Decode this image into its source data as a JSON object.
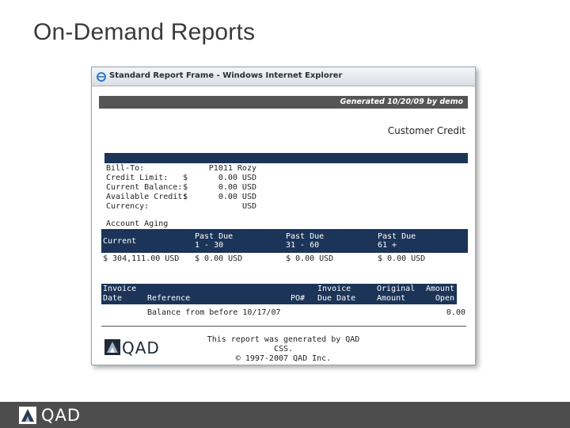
{
  "slide": {
    "title": "On-Demand Reports"
  },
  "window": {
    "title": "Standard Report Frame - Windows Internet Explorer"
  },
  "report": {
    "generated": "Generated 10/20/09 by demo",
    "title": "Customer Credit",
    "info": [
      {
        "label": "Bill-To:",
        "currency_symbol": "",
        "value": "P1011 Rozy"
      },
      {
        "label": "Credit Limit:",
        "currency_symbol": "$",
        "value": "0.00 USD"
      },
      {
        "label": "Current Balance:",
        "currency_symbol": "$",
        "value": "0.00 USD"
      },
      {
        "label": "Available Credit:",
        "currency_symbol": "$",
        "value": "0.00 USD"
      },
      {
        "label": "Currency:",
        "currency_symbol": "",
        "value": "USD"
      }
    ],
    "aging": {
      "title": "Account Aging",
      "headers": [
        {
          "line1": "Current",
          "line2": ""
        },
        {
          "line1": "Past Due",
          "line2": "1 - 30"
        },
        {
          "line1": "Past Due",
          "line2": "31 - 60"
        },
        {
          "line1": "Past Due",
          "line2": "61 +"
        }
      ],
      "values": [
        "$ 304,111.00 USD",
        "$ 0.00 USD",
        "$ 0.00 USD",
        "$ 0.00 USD"
      ]
    },
    "invoice": {
      "headers": [
        {
          "line1": "Invoice",
          "line2": "Date"
        },
        {
          "line1": "",
          "line2": "Reference"
        },
        {
          "line1": "",
          "line2": "PO#"
        },
        {
          "line1": "Invoice",
          "line2": "Due Date"
        },
        {
          "line1": "Original",
          "line2": "Amount"
        },
        {
          "line1": "Amount",
          "line2": "Open"
        }
      ],
      "row": {
        "reference": "Balance from before 10/17/07",
        "amount_open": "0.00"
      }
    },
    "logo_text": "QAD",
    "footer_line1": "This report was generated by QAD CSS.",
    "footer_line2": "© 1997-2007 QAD Inc."
  },
  "footer": {
    "logo_text": "QAD"
  },
  "colors": {
    "navy": "#1b3458",
    "generated_bar": "#555555",
    "bottom_bar": "#4d4d4d"
  }
}
